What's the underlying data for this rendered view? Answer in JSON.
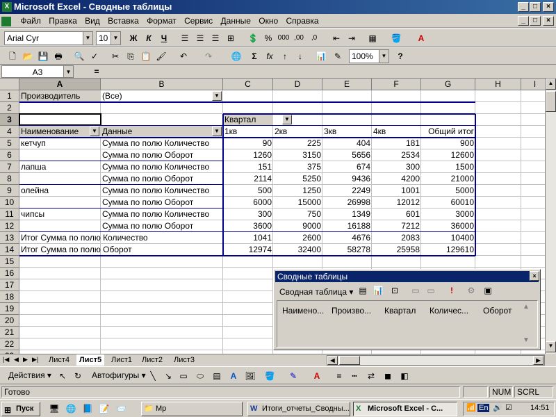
{
  "window": {
    "title": "Microsoft Excel - Сводные таблицы",
    "icon": "X"
  },
  "menu": {
    "items": [
      "Файл",
      "Правка",
      "Вид",
      "Вставка",
      "Формат",
      "Сервис",
      "Данные",
      "Окно",
      "Справка"
    ]
  },
  "formatting": {
    "font": "Arial Cyr",
    "size": "10",
    "bold": "Ж",
    "italic": "К",
    "underline": "Ч",
    "percent": "%",
    "thousands": "000",
    "inc_dec": ",00",
    "dec_dec": ",0"
  },
  "standard": {
    "zoom": "100%",
    "autosum": "Σ",
    "function": "fx",
    "help": "?"
  },
  "formula_bar": {
    "name_box": "A3",
    "equals": "=",
    "value": ""
  },
  "columns": [
    "A",
    "B",
    "C",
    "D",
    "E",
    "F",
    "G",
    "H",
    "I"
  ],
  "rows": [
    "1",
    "2",
    "3",
    "4",
    "5",
    "6",
    "7",
    "8",
    "9",
    "10",
    "11",
    "12",
    "13",
    "14",
    "15",
    "16",
    "17",
    "18",
    "19",
    "20",
    "21",
    "22",
    "23"
  ],
  "pivot": {
    "page_field": "Производитель",
    "page_value": "(Все)",
    "col_field": "Квартал",
    "row_field": "Наименование",
    "data_field": "Данные",
    "col_headers": [
      "1кв",
      "2кв",
      "3кв",
      "4кв",
      "Общий итог"
    ],
    "groups": [
      {
        "name": "кетчуп",
        "rows": [
          {
            "label": "Сумма по полю Количество",
            "values": [
              "90",
              "225",
              "404",
              "181",
              "900"
            ]
          },
          {
            "label": "Сумма по полю Оборот",
            "values": [
              "1260",
              "3150",
              "5656",
              "2534",
              "12600"
            ]
          }
        ]
      },
      {
        "name": "лапша",
        "rows": [
          {
            "label": "Сумма по полю Количество",
            "values": [
              "151",
              "375",
              "674",
              "300",
              "1500"
            ]
          },
          {
            "label": "Сумма по полю Оборот",
            "values": [
              "2114",
              "5250",
              "9436",
              "4200",
              "21000"
            ]
          }
        ]
      },
      {
        "name": "олейна",
        "rows": [
          {
            "label": "Сумма по полю Количество",
            "values": [
              "500",
              "1250",
              "2249",
              "1001",
              "5000"
            ]
          },
          {
            "label": "Сумма по полю Оборот",
            "values": [
              "6000",
              "15000",
              "26998",
              "12012",
              "60010"
            ]
          }
        ]
      },
      {
        "name": "чипсы",
        "rows": [
          {
            "label": "Сумма по полю Количество",
            "values": [
              "300",
              "750",
              "1349",
              "601",
              "3000"
            ]
          },
          {
            "label": "Сумма по полю Оборот",
            "values": [
              "3600",
              "9000",
              "16188",
              "7212",
              "36000"
            ]
          }
        ]
      }
    ],
    "totals": [
      {
        "label": "Итог Сумма по полю Количество",
        "values": [
          "1041",
          "2600",
          "4676",
          "2083",
          "10400"
        ]
      },
      {
        "label": "Итог Сумма по полю Оборот",
        "values": [
          "12974",
          "32400",
          "58278",
          "25958",
          "129610"
        ]
      }
    ]
  },
  "sheets": [
    "Лист4",
    "Лист5",
    "Лист1",
    "Лист2",
    "Лист3"
  ],
  "active_sheet": "Лист5",
  "pivot_toolbar": {
    "title": "Сводные таблицы",
    "menu": "Сводная таблица ▾",
    "fields": [
      "Наимено...",
      "Произво...",
      "Квартал",
      "Количес...",
      "Оборот"
    ]
  },
  "drawing": {
    "actions": "Действия ▾",
    "autoshapes": "Автофигуры ▾"
  },
  "status": {
    "ready": "Готово",
    "num": "NUM",
    "scrl": "SCRL"
  },
  "taskbar": {
    "start": "Пуск",
    "tasks": [
      "Mp",
      "Итоги_отчеты_Сводны...",
      "Microsoft Excel - С..."
    ],
    "lang": "En",
    "time": "14:51"
  },
  "colors": {
    "title_start": "#0a246a",
    "title_end": "#3a6ea5",
    "pivot_border": "#00008b"
  }
}
